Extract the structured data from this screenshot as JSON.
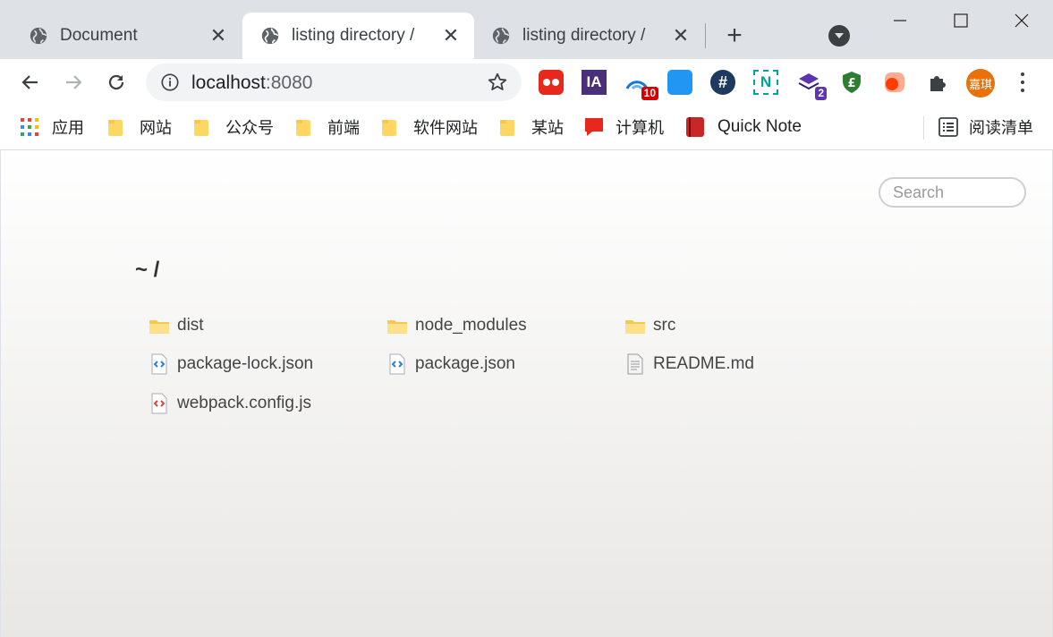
{
  "tabs": [
    {
      "title": "Document",
      "active": false,
      "close": "✕"
    },
    {
      "title": "listing directory /",
      "active": true,
      "close": "✕"
    },
    {
      "title": "listing directory /",
      "active": false,
      "close": "✕"
    }
  ],
  "window": {
    "new_tab": "+"
  },
  "toolbar": {
    "url_host": "localhost",
    "url_port": ":8080",
    "extensions": [
      {
        "name": "tracking-ext-icon",
        "color": "#e8281d"
      },
      {
        "name": "ia-ext-icon",
        "label": "IA",
        "color": "#5b3a8c"
      },
      {
        "name": "fast-ext-icon",
        "badge": "10",
        "color": "#1976d2"
      },
      {
        "name": "blue-ext-icon",
        "color": "#2196f3"
      },
      {
        "name": "hashnode-ext-icon",
        "label": "#",
        "color": "#1e3a5f"
      },
      {
        "name": "n-ext-icon",
        "label": "N",
        "color": "#00a3a3"
      },
      {
        "name": "stack-ext-icon",
        "badge": "2",
        "color": "#5e35b1"
      },
      {
        "name": "shield-ext-icon",
        "label": "£",
        "color": "#2e7d32"
      },
      {
        "name": "orange-ext-icon",
        "color": "#ff5722"
      }
    ],
    "avatar_text": "嘉琪"
  },
  "bookmarks": {
    "apps": "应用",
    "folders": [
      "网站",
      "公众号",
      "前端",
      "软件网站",
      "某站"
    ],
    "computer": "计算机",
    "quicknote": "Quick Note",
    "reading_list": "阅读清单"
  },
  "page": {
    "search_placeholder": "Search",
    "path": "~ /",
    "files": [
      {
        "name": "dist",
        "type": "folder"
      },
      {
        "name": "node_modules",
        "type": "folder"
      },
      {
        "name": "src",
        "type": "folder"
      },
      {
        "name": "package-lock.json",
        "type": "json"
      },
      {
        "name": "package.json",
        "type": "json"
      },
      {
        "name": "README.md",
        "type": "text"
      },
      {
        "name": "webpack.config.js",
        "type": "js"
      }
    ]
  }
}
